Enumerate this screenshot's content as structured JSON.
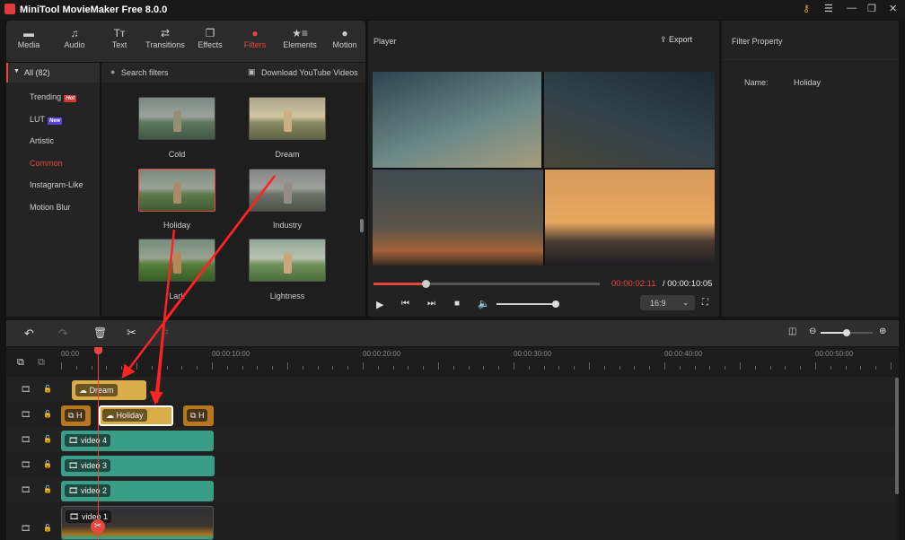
{
  "app": {
    "title": "MiniTool MovieMaker Free 8.0.0"
  },
  "toolbar": [
    {
      "icon": "folder-icon",
      "label": "Media"
    },
    {
      "icon": "music-icon",
      "label": "Audio"
    },
    {
      "icon": "text-icon",
      "label": "Text"
    },
    {
      "icon": "transitions-icon",
      "label": "Transitions"
    },
    {
      "icon": "effects-icon",
      "label": "Effects"
    },
    {
      "icon": "filters-icon",
      "label": "Filters",
      "active": true
    },
    {
      "icon": "elements-icon",
      "label": "Elements"
    },
    {
      "icon": "motion-icon",
      "label": "Motion"
    }
  ],
  "categories": {
    "all": "All (82)",
    "items": [
      {
        "label": "Trending",
        "badge": "Hot",
        "badge_color": "#d8322c"
      },
      {
        "label": "LUT",
        "badge": "New",
        "badge_color": "#5b3fe0"
      },
      {
        "label": "Artistic"
      },
      {
        "label": "Common",
        "active": true
      },
      {
        "label": "Instagram-Like"
      },
      {
        "label": "Motion Blur"
      }
    ]
  },
  "filters": {
    "search_placeholder": "Search filters",
    "download": "Download YouTube Videos",
    "items": [
      "Cold",
      "Dream",
      "Holiday",
      "Industry",
      "Lark",
      "Lightness"
    ],
    "selected": "Holiday"
  },
  "player": {
    "title": "Player",
    "export": "Export",
    "current_time": "00:00:02:11",
    "total_time": "/ 00:00:10:05",
    "progress": 0.23,
    "volume": 1.0,
    "aspect": "16:9"
  },
  "filter_property": {
    "title": "Filter Property",
    "name_label": "Name:",
    "name_value": "Holiday"
  },
  "timeline": {
    "ruler": [
      "00:00",
      "00:00:10:00",
      "00:00:20:00",
      "00:00:30:00",
      "00:00:40:00",
      "00:00:50:00"
    ],
    "clips": {
      "dream": "Dream",
      "holiday": "Holiday",
      "trans1": "H",
      "trans2": "H",
      "v4": "video 4",
      "v3": "video 3",
      "v2": "video 2",
      "v1": "video 1"
    }
  },
  "colors": {
    "accent": "#e8463e",
    "filter_clip": "#d9ae4a",
    "video_clip": "#3a9e86",
    "transition_clip": "#b8771e"
  }
}
